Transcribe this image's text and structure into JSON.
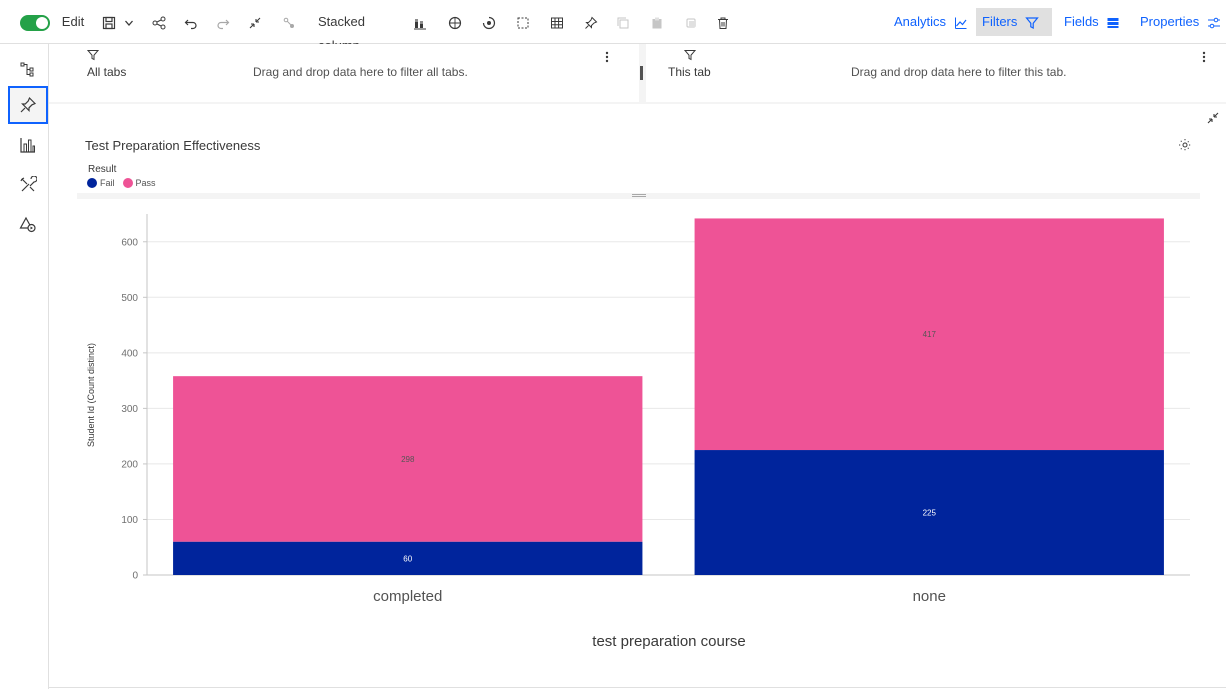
{
  "toolbar": {
    "edit_label": "Edit",
    "chart_type_label": "Stacked column",
    "analytics_label": "Analytics",
    "filters_label": "Filters",
    "fields_label": "Fields",
    "properties_label": "Properties",
    "toggle_color": "#24a148",
    "link_color": "#0f62fe"
  },
  "rail": {
    "items": [
      {
        "icon": "data-tree-icon"
      },
      {
        "icon": "pin-icon",
        "selected": true
      },
      {
        "icon": "bar-chart-icon"
      },
      {
        "icon": "tools-icon"
      },
      {
        "icon": "shapes-icon"
      }
    ]
  },
  "filters": {
    "all_tabs": {
      "label": "All tabs",
      "hint": "Drag and drop data here to filter all tabs."
    },
    "this_tab": {
      "label": "This tab",
      "hint": "Drag and drop data here to filter this tab."
    }
  },
  "viz": {
    "title": "Test Preparation Effectiveness"
  },
  "chart_data": {
    "type": "bar",
    "stacked": true,
    "categories": [
      "completed",
      "none"
    ],
    "series": [
      {
        "name": "Fail",
        "values": [
          60,
          225
        ],
        "color": "#00249c"
      },
      {
        "name": "Pass",
        "values": [
          298,
          417
        ],
        "color": "#ee5396"
      }
    ],
    "legend_title": "Result",
    "legend_position": "top-left",
    "xlabel": "test preparation course",
    "ylabel": "Student Id (Count distinct)",
    "ylim": [
      0,
      650
    ],
    "yticks": [
      0,
      100,
      200,
      300,
      400,
      500,
      600
    ],
    "grid": true
  }
}
